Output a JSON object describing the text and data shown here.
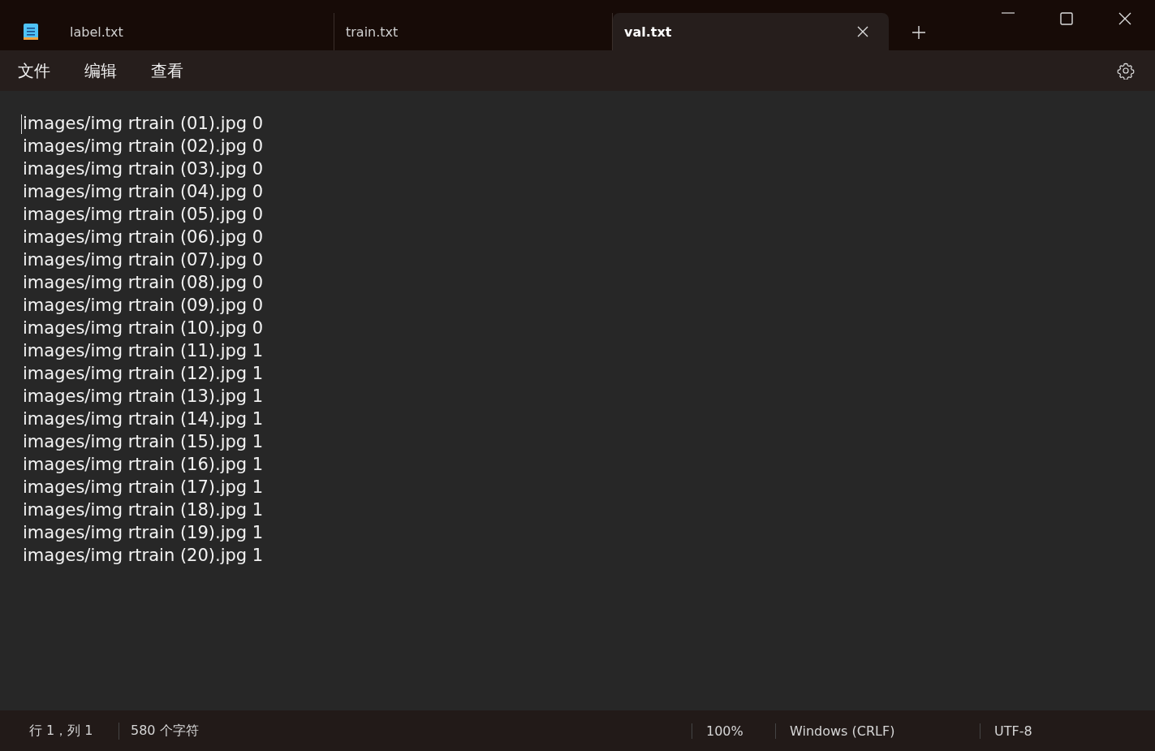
{
  "tabs": [
    {
      "label": "label.txt",
      "selected": false
    },
    {
      "label": "train.txt",
      "selected": false
    },
    {
      "label": "val.txt",
      "selected": true
    }
  ],
  "menu": [
    "文件",
    "编辑",
    "查看"
  ],
  "editor": {
    "lines": [
      "images/img rtrain (01).jpg 0",
      "images/img rtrain (02).jpg 0",
      "images/img rtrain (03).jpg 0",
      "images/img rtrain (04).jpg 0",
      "images/img rtrain (05).jpg 0",
      "images/img rtrain (06).jpg 0",
      "images/img rtrain (07).jpg 0",
      "images/img rtrain (08).jpg 0",
      "images/img rtrain (09).jpg 0",
      "images/img rtrain (10).jpg 0",
      "images/img rtrain (11).jpg 1",
      "images/img rtrain (12).jpg 1",
      "images/img rtrain (13).jpg 1",
      "images/img rtrain (14).jpg 1",
      "images/img rtrain (15).jpg 1",
      "images/img rtrain (16).jpg 1",
      "images/img rtrain (17).jpg 1",
      "images/img rtrain (18).jpg 1",
      "images/img rtrain (19).jpg 1",
      "images/img rtrain (20).jpg 1"
    ]
  },
  "status_bar": {
    "position": "行 1，列 1",
    "characters": "580 个字符",
    "zoom": "100%",
    "line_ending": "Windows (CRLF)",
    "encoding": "UTF-8"
  }
}
